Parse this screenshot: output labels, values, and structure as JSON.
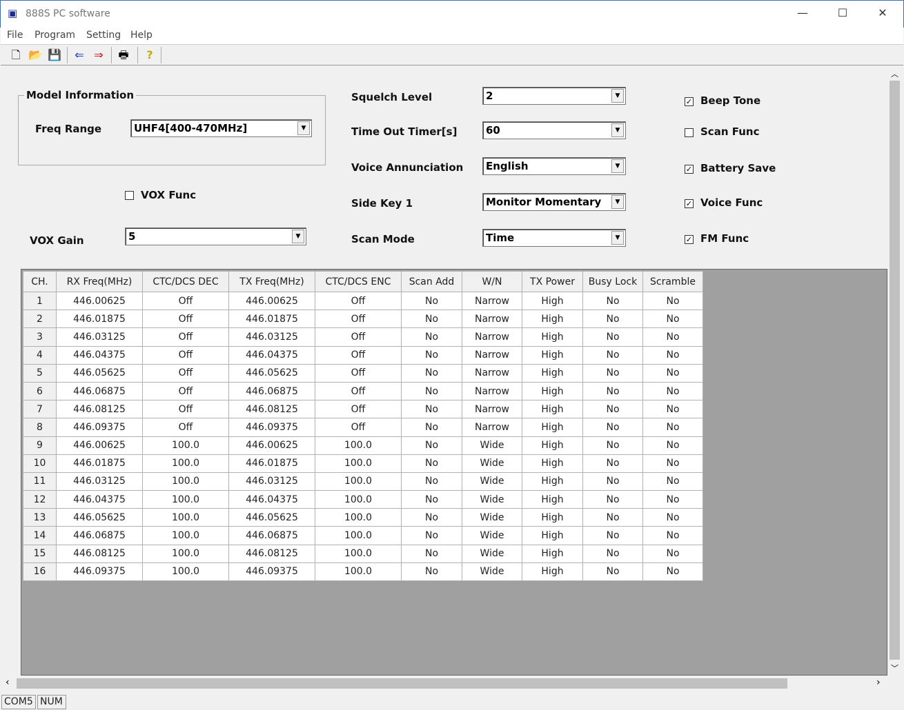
{
  "window": {
    "title": "888S PC software",
    "minimize": "—",
    "maximize": "☐",
    "close": "✕"
  },
  "menu": [
    "File",
    "Program",
    "Setting",
    "Help"
  ],
  "toolbar": [
    {
      "icon": "new-file-icon",
      "glyph": "🗋"
    },
    {
      "icon": "open-folder-icon",
      "glyph": "📂"
    },
    {
      "icon": "save-icon",
      "glyph": "💾"
    },
    {
      "icon": "read-from-radio-icon",
      "glyph": "⇐"
    },
    {
      "icon": "write-to-radio-icon",
      "glyph": "⇒"
    },
    {
      "icon": "print-icon",
      "glyph": "🖶"
    },
    {
      "icon": "help-icon",
      "glyph": "?"
    }
  ],
  "model": {
    "group": "Model Information",
    "freq_label": "Freq Range",
    "freq_value": "UHF4[400-470MHz]"
  },
  "vox": {
    "func_label": "VOX Func",
    "func_checked": false,
    "gain_label": "VOX Gain",
    "gain_value": "5"
  },
  "settings": [
    {
      "label": "Squelch Level",
      "value": "2"
    },
    {
      "label": "Time Out Timer[s]",
      "value": "60"
    },
    {
      "label": "Voice Annunciation",
      "value": "English"
    },
    {
      "label": "Side Key 1",
      "value": "Monitor Momentary"
    },
    {
      "label": "Scan Mode",
      "value": "Time"
    }
  ],
  "checks": [
    {
      "label": "Beep Tone",
      "checked": true
    },
    {
      "label": "Scan Func",
      "checked": false
    },
    {
      "label": "Battery Save",
      "checked": true
    },
    {
      "label": "Voice Func",
      "checked": true
    },
    {
      "label": "FM Func",
      "checked": true
    }
  ],
  "table": {
    "columns": [
      "CH.",
      "RX Freq(MHz)",
      "CTC/DCS DEC",
      "TX Freq(MHz)",
      "CTC/DCS ENC",
      "Scan Add",
      "W/N",
      "TX Power",
      "Busy Lock",
      "Scramble"
    ],
    "rows": [
      [
        "1",
        "446.00625",
        "Off",
        "446.00625",
        "Off",
        "No",
        "Narrow",
        "High",
        "No",
        "No"
      ],
      [
        "2",
        "446.01875",
        "Off",
        "446.01875",
        "Off",
        "No",
        "Narrow",
        "High",
        "No",
        "No"
      ],
      [
        "3",
        "446.03125",
        "Off",
        "446.03125",
        "Off",
        "No",
        "Narrow",
        "High",
        "No",
        "No"
      ],
      [
        "4",
        "446.04375",
        "Off",
        "446.04375",
        "Off",
        "No",
        "Narrow",
        "High",
        "No",
        "No"
      ],
      [
        "5",
        "446.05625",
        "Off",
        "446.05625",
        "Off",
        "No",
        "Narrow",
        "High",
        "No",
        "No"
      ],
      [
        "6",
        "446.06875",
        "Off",
        "446.06875",
        "Off",
        "No",
        "Narrow",
        "High",
        "No",
        "No"
      ],
      [
        "7",
        "446.08125",
        "Off",
        "446.08125",
        "Off",
        "No",
        "Narrow",
        "High",
        "No",
        "No"
      ],
      [
        "8",
        "446.09375",
        "Off",
        "446.09375",
        "Off",
        "No",
        "Narrow",
        "High",
        "No",
        "No"
      ],
      [
        "9",
        "446.00625",
        "100.0",
        "446.00625",
        "100.0",
        "No",
        "Wide",
        "High",
        "No",
        "No"
      ],
      [
        "10",
        "446.01875",
        "100.0",
        "446.01875",
        "100.0",
        "No",
        "Wide",
        "High",
        "No",
        "No"
      ],
      [
        "11",
        "446.03125",
        "100.0",
        "446.03125",
        "100.0",
        "No",
        "Wide",
        "High",
        "No",
        "No"
      ],
      [
        "12",
        "446.04375",
        "100.0",
        "446.04375",
        "100.0",
        "No",
        "Wide",
        "High",
        "No",
        "No"
      ],
      [
        "13",
        "446.05625",
        "100.0",
        "446.05625",
        "100.0",
        "No",
        "Wide",
        "High",
        "No",
        "No"
      ],
      [
        "14",
        "446.06875",
        "100.0",
        "446.06875",
        "100.0",
        "No",
        "Wide",
        "High",
        "No",
        "No"
      ],
      [
        "15",
        "446.08125",
        "100.0",
        "446.08125",
        "100.0",
        "No",
        "Wide",
        "High",
        "No",
        "No"
      ],
      [
        "16",
        "446.09375",
        "100.0",
        "446.09375",
        "100.0",
        "No",
        "Wide",
        "High",
        "No",
        "No"
      ]
    ]
  },
  "status": [
    "COM5",
    "NUM"
  ]
}
